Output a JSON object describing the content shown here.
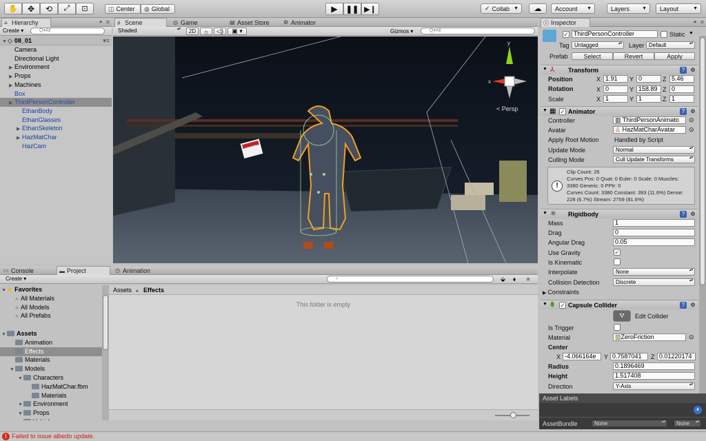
{
  "toolbar": {
    "pivot_label": "Center",
    "space_label": "Global",
    "collab_label": "Collab",
    "account_label": "Account",
    "layers_label": "Layers",
    "layout_label": "Layout"
  },
  "hierarchy": {
    "tab": "Hierarchy",
    "create": "Create",
    "search_placeholder": "Q▾All",
    "scene": "08_01",
    "items": [
      {
        "label": "Camera",
        "indent": 1,
        "arrow": false,
        "blue": false,
        "selected": false
      },
      {
        "label": "Directional Light",
        "indent": 1,
        "arrow": false,
        "blue": false,
        "selected": false
      },
      {
        "label": "Environment",
        "indent": 1,
        "arrow": true,
        "blue": false,
        "selected": false
      },
      {
        "label": "Props",
        "indent": 1,
        "arrow": true,
        "blue": false,
        "selected": false
      },
      {
        "label": "Machines",
        "indent": 1,
        "arrow": true,
        "blue": false,
        "selected": false
      },
      {
        "label": "Box",
        "indent": 1,
        "arrow": false,
        "blue": true,
        "selected": false
      },
      {
        "label": "ThirdPersonController",
        "indent": 1,
        "arrow": true,
        "blue": true,
        "selected": true
      },
      {
        "label": "EthanBody",
        "indent": 2,
        "arrow": false,
        "blue": true,
        "selected": false
      },
      {
        "label": "EthanGlasses",
        "indent": 2,
        "arrow": false,
        "blue": true,
        "selected": false
      },
      {
        "label": "EthanSkeleton",
        "indent": 2,
        "arrow": true,
        "blue": true,
        "selected": false
      },
      {
        "label": "HazMatChar",
        "indent": 2,
        "arrow": true,
        "blue": true,
        "selected": false
      },
      {
        "label": "HazCam",
        "indent": 2,
        "arrow": false,
        "blue": true,
        "selected": false
      }
    ]
  },
  "scene_tabs": {
    "scene": "Scene",
    "game": "Game",
    "asset_store": "Asset Store",
    "animator": "Animator"
  },
  "scene_bar": {
    "shading": "Shaded",
    "mode2d": "2D",
    "gizmos": "Gizmos",
    "search_placeholder": "Q▾All"
  },
  "scene_view": {
    "persp_label": "< Persp",
    "gizmo_x": "x",
    "gizmo_y": "y",
    "sign_text": "DANGER"
  },
  "bottom_tabs": {
    "console": "Console",
    "project": "Project",
    "animation": "Animation"
  },
  "project": {
    "create": "Create",
    "tree": [
      {
        "label": "Favorites",
        "indent": 0,
        "arrow": true,
        "kind": "star",
        "bold": true,
        "selected": false
      },
      {
        "label": "All Materials",
        "indent": 1,
        "arrow": false,
        "kind": "search",
        "bold": false,
        "selected": false
      },
      {
        "label": "All Models",
        "indent": 1,
        "arrow": false,
        "kind": "search",
        "bold": false,
        "selected": false
      },
      {
        "label": "All Prefabs",
        "indent": 1,
        "arrow": false,
        "kind": "search",
        "bold": false,
        "selected": false
      },
      {
        "label": "",
        "indent": 0,
        "arrow": false,
        "kind": "none",
        "bold": false,
        "selected": false
      },
      {
        "label": "Assets",
        "indent": 0,
        "arrow": true,
        "kind": "folder",
        "bold": true,
        "selected": false
      },
      {
        "label": "Animation",
        "indent": 1,
        "arrow": false,
        "kind": "folder",
        "bold": false,
        "selected": false
      },
      {
        "label": "Effects",
        "indent": 1,
        "arrow": false,
        "kind": "folder",
        "bold": false,
        "selected": true
      },
      {
        "label": "Materials",
        "indent": 1,
        "arrow": false,
        "kind": "folder",
        "bold": false,
        "selected": false
      },
      {
        "label": "Models",
        "indent": 1,
        "arrow": true,
        "kind": "folder",
        "bold": false,
        "selected": false
      },
      {
        "label": "Characters",
        "indent": 2,
        "arrow": true,
        "kind": "folder",
        "bold": false,
        "selected": false
      },
      {
        "label": "HazMatChar.fbm",
        "indent": 3,
        "arrow": false,
        "kind": "folder",
        "bold": false,
        "selected": false
      },
      {
        "label": "Materials",
        "indent": 3,
        "arrow": false,
        "kind": "folder",
        "bold": false,
        "selected": false
      },
      {
        "label": "Environment",
        "indent": 2,
        "arrow": true,
        "kind": "folder",
        "bold": false,
        "selected": false
      },
      {
        "label": "Props",
        "indent": 2,
        "arrow": true,
        "kind": "folder",
        "bold": false,
        "selected": false
      },
      {
        "label": "Vehicles",
        "indent": 2,
        "arrow": false,
        "kind": "folder",
        "bold": false,
        "selected": false
      }
    ],
    "breadcrumb_root": "Assets",
    "breadcrumb_sep": "►",
    "breadcrumb_current": "Effects",
    "empty_text": "This folder is empty"
  },
  "inspector": {
    "tab": "Inspector",
    "object_name": "ThirdPersonController",
    "static_label": "Static",
    "tag_label": "Tag",
    "tag_value": "Untagged",
    "layer_label": "Layer",
    "layer_value": "Default",
    "prefab_label": "Prefab",
    "select": "Select",
    "revert": "Revert",
    "apply": "Apply",
    "transform": {
      "title": "Transform",
      "position": "Position",
      "rotation": "Rotation",
      "scale": "Scale",
      "x": "X",
      "y": "Y",
      "z": "Z",
      "pos": [
        "1.91",
        "0",
        "5.46"
      ],
      "rot": [
        "0",
        "158.89",
        "0"
      ],
      "scl": [
        "1",
        "1",
        "1"
      ]
    },
    "animator": {
      "title": "Animator",
      "controller_label": "Controller",
      "controller_value": "ThirdPersonAnimato",
      "avatar_label": "Avatar",
      "avatar_value": "HazMatCharAvatar",
      "root_label": "Apply Root Motion",
      "root_value": "Handled by Script",
      "update_label": "Update Mode",
      "update_value": "Normal",
      "culling_label": "Culling Mode",
      "culling_value": "Cull Update Transforms",
      "info": [
        "Clip Count: 26",
        "Curves Pos: 0 Quat: 0 Euler: 0 Scale: 0 Muscles:",
        "3380 Generic: 0 PPtr: 0",
        "Curves Count: 3380 Constant: 393 (11.6%) Dense:",
        "228 (6.7%) Stream: 2759 (81.6%)"
      ]
    },
    "rigidbody": {
      "title": "Rigidbody",
      "mass_label": "Mass",
      "mass": "1",
      "drag_label": "Drag",
      "drag": "0",
      "adrag_label": "Angular Drag",
      "adrag": "0.05",
      "gravity_label": "Use Gravity",
      "kinematic_label": "Is Kinematic",
      "interp_label": "Interpolate",
      "interp": "None",
      "coll_label": "Collision Detection",
      "coll": "Discrete",
      "constraints_label": "Constraints"
    },
    "capsule": {
      "title": "Capsule Collider",
      "edit_label": "Edit Collider",
      "trigger_label": "Is Trigger",
      "material_label": "Material",
      "material_value": "ZeroFriction",
      "center_label": "Center",
      "cx": "-4.066164e",
      "cy": "0.7587041",
      "cz": "0.01220174",
      "radius_label": "Radius",
      "radius": "0.1896469",
      "height_label": "Height",
      "height": "1.517408",
      "dir_label": "Direction",
      "dir": "Y-Axis"
    },
    "asset_labels": "Asset Labels",
    "asset_bundle_label": "AssetBundle",
    "bundle_value": "None",
    "bundle_variant": "None"
  },
  "status": {
    "message": "Failed to issue albedo update."
  }
}
